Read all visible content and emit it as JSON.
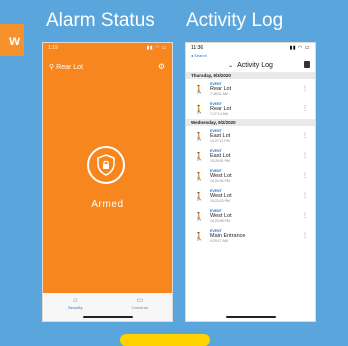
{
  "edge_tab": "w",
  "headings": {
    "left": "Alarm Status",
    "right": "Activity Log"
  },
  "alarm_phone": {
    "time": "1:19",
    "location": "Rear Lot",
    "status": "Armed",
    "tabs": [
      "Security",
      "Cameras"
    ],
    "colors": {
      "accent": "#f7861f",
      "active_tab": "#1d74d6"
    }
  },
  "log_phone": {
    "time": "11:36",
    "back": "◂ Search",
    "title": "Activity Log",
    "groups": [
      {
        "date": "Thursday, 9/3/2020",
        "entries": [
          {
            "label": "EVENT",
            "location": "Rear Lot",
            "time": "7:48:01 AM"
          },
          {
            "label": "EVENT",
            "location": "Rear Lot",
            "time": "7:47:10 AM"
          }
        ]
      },
      {
        "date": "Wednesday, 9/2/2020",
        "entries": [
          {
            "label": "EVENT",
            "location": "East Lot",
            "time": "10:27:11 PM"
          },
          {
            "label": "EVENT",
            "location": "East Lot",
            "time": "10:26:51 PM"
          },
          {
            "label": "EVENT",
            "location": "West Lot",
            "time": "10:24:34 PM"
          },
          {
            "label": "EVENT",
            "location": "West Lot",
            "time": "10:23:23 PM"
          },
          {
            "label": "EVENT",
            "location": "West Lot",
            "time": "10:23:08 PM"
          },
          {
            "label": "EVENT",
            "location": "Main Entrance",
            "time": "4:29:17 AM"
          }
        ]
      }
    ]
  }
}
